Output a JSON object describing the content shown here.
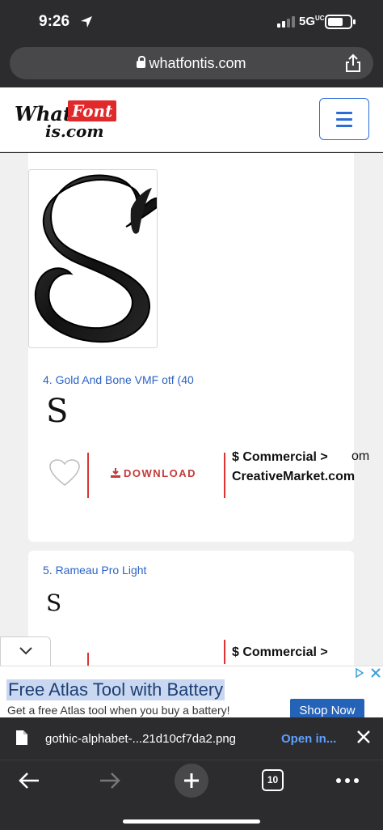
{
  "status": {
    "time": "9:26",
    "network": "5G",
    "network_sup": "UC"
  },
  "browser": {
    "url": "whatfontis.com"
  },
  "site": {
    "logo_what": "What",
    "logo_font": "Font",
    "logo_com": "is.com"
  },
  "results": [
    {
      "side_text": "om",
      "title": "4. Gold And Bone VMF otf (40",
      "sample": "S",
      "download_label": "DOWNLOAD",
      "commercial_line1": "$ Commercial >",
      "commercial_line2": "CreativeMarket.com"
    },
    {
      "title": "5. Rameau Pro Light",
      "sample": "S",
      "commercial_line1": "$ Commercial >"
    }
  ],
  "ad": {
    "title": "Free Atlas Tool with Battery",
    "subtitle": "Get a free Atlas tool when you buy a battery!",
    "cta": "Shop Now"
  },
  "download_bar": {
    "filename": "gothic-alphabet-...21d10cf7da2.png",
    "open_label": "Open in..."
  },
  "toolbar": {
    "tab_count": "10"
  },
  "colors": {
    "accent_blue": "#2b6cd8",
    "brand_red": "#e0292a",
    "download_red": "#c43a3a",
    "chrome_dark": "#2c2c2e"
  }
}
